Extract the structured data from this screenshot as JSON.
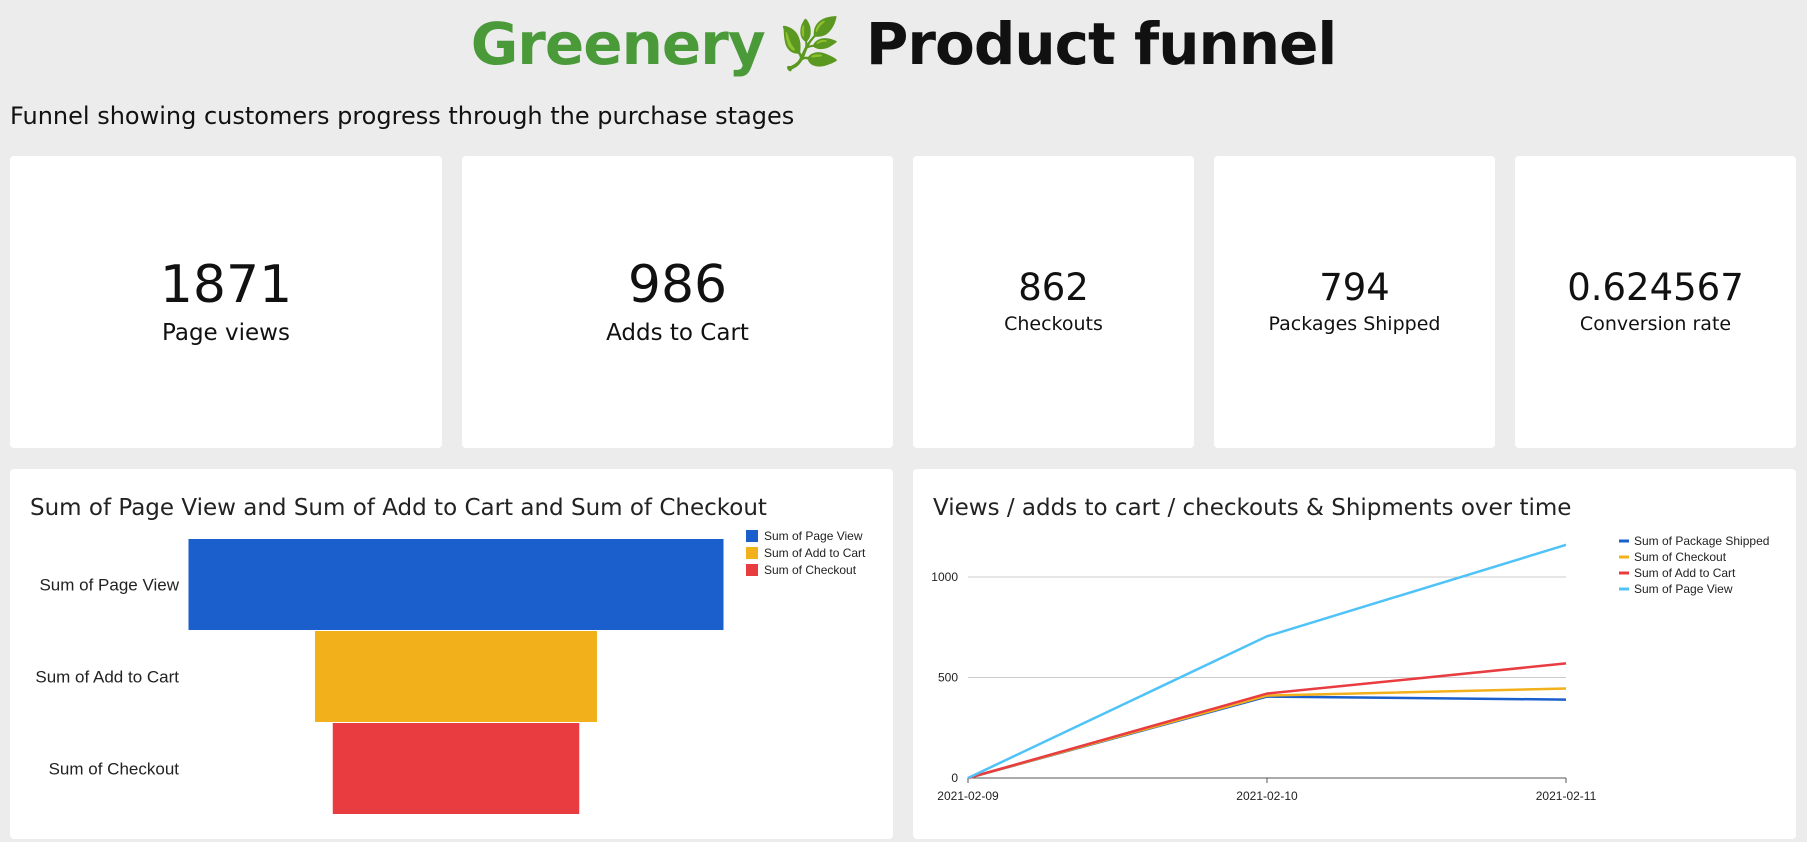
{
  "header": {
    "brand": "Greenery",
    "leaf_icon": "🌿",
    "title": "Product funnel",
    "brand_color": "#4a9a3a"
  },
  "subtitle": "Funnel showing customers progress through the purchase stages",
  "kpis": [
    {
      "value": "1871",
      "label": "Page views"
    },
    {
      "value": "986",
      "label": "Adds to Cart"
    },
    {
      "value": "862",
      "label": "Checkouts"
    },
    {
      "value": "794",
      "label": "Packages Shipped"
    },
    {
      "value": "0.624567",
      "label": "Conversion rate"
    }
  ],
  "chart_data": [
    {
      "type": "bar",
      "title": "Sum of Page View and Sum of Add to Cart and Sum of Checkout",
      "subtype": "funnel",
      "categories": [
        "Sum of Page View",
        "Sum of Add to Cart",
        "Sum of Checkout"
      ],
      "values": [
        1871,
        986,
        862
      ],
      "colors": [
        "#1a5fcb",
        "#f2b01a",
        "#e83c40"
      ],
      "legend": [
        "Sum of Page View",
        "Sum of Add to Cart",
        "Sum of Checkout"
      ],
      "legend_position": "top-right"
    },
    {
      "type": "line",
      "title": "Views / adds to cart / checkouts & Shipments over time",
      "x": [
        "2021-02-09",
        "2021-02-10",
        "2021-02-11"
      ],
      "ylim": [
        0,
        1000
      ],
      "yticks": [
        0,
        500,
        1000
      ],
      "grid": true,
      "legend_position": "top-right",
      "series": [
        {
          "name": "Sum of Package Shipped",
          "color": "#1a5fcb",
          "values": [
            0,
            405,
            390
          ]
        },
        {
          "name": "Sum of Checkout",
          "color": "#f2b01a",
          "values": [
            0,
            410,
            445
          ]
        },
        {
          "name": "Sum of Add to Cart",
          "color": "#e83c40",
          "values": [
            0,
            420,
            570
          ]
        },
        {
          "name": "Sum of Page View",
          "color": "#4fc3f7",
          "values": [
            0,
            705,
            1160
          ]
        }
      ]
    }
  ]
}
